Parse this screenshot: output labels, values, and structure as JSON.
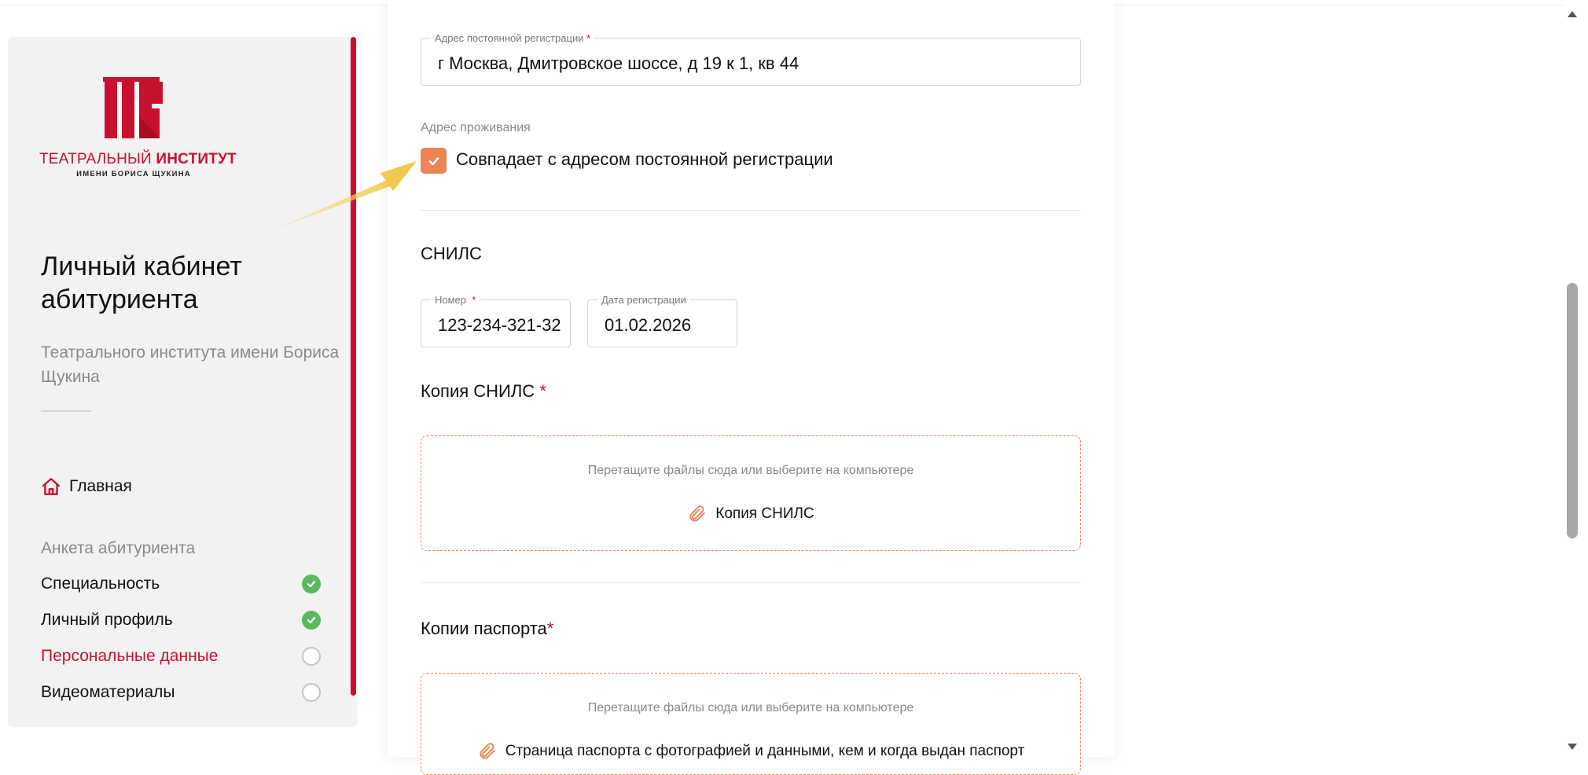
{
  "sidebar": {
    "logo_text_regular": "ТЕАТРАЛЬНЫЙ ",
    "logo_text_bold": "ИНСТИТУТ",
    "logo_subtitle": "ИМЕНИ БОРИСА ЩУКИНА",
    "cabinet_title": "Личный кабинет абитуриента",
    "cabinet_subtitle": "Театрального института имени Бориса Щукина",
    "home_label": "Главная",
    "section_label": "Анкета абитуриента",
    "items": [
      {
        "label": "Специальность",
        "status": "done"
      },
      {
        "label": "Личный профиль",
        "status": "done"
      },
      {
        "label": "Персональные данные",
        "status": "todo",
        "active": true
      },
      {
        "label": "Видеоматериалы",
        "status": "todo"
      }
    ]
  },
  "form": {
    "registration_address": {
      "label": "Адрес постоянной регистрации",
      "required_mark": "*",
      "value": "г Москва, Дмитровское шоссе, д 19 к 1, кв 44"
    },
    "residence": {
      "label": "Адрес проживания",
      "checkbox_label": "Совпадает с адресом постоянной регистрации",
      "checked": true
    },
    "snils": {
      "title": "СНИЛС",
      "number_label": "Номер",
      "number_required": "*",
      "number_value": "123-234-321-32",
      "date_label": "Дата регистрации",
      "date_value": "01.02.2026"
    },
    "snils_copy": {
      "title": "Копия СНИЛС",
      "required_mark": "*",
      "hint": "Перетащите файлы сюда или выберите на компьютере",
      "file_label": "Копия СНИЛС"
    },
    "passport_copies": {
      "title": "Копии паспорта",
      "required_mark": "*",
      "hint": "Перетащите файлы сюда или выберите на компьютере",
      "file_label": "Страница паспорта с фотографией и данными, кем и когда выдан паспорт"
    }
  },
  "colors": {
    "brand_red": "#c8102e",
    "accent_orange": "#ec8454",
    "success_green": "#5cb85c"
  }
}
